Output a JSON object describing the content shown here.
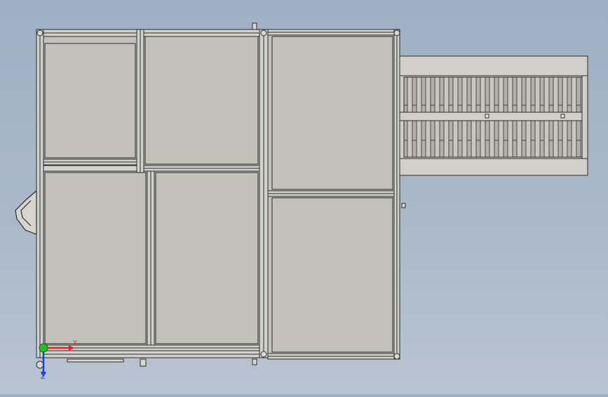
{
  "viewport": {
    "background_top": "#9fb0c4",
    "background_bottom": "#b8c4d2",
    "panel_fill": "#c2c2ba",
    "frame_color": "#2b2b2b",
    "frame_fill": "#d2d2cc"
  },
  "triad": {
    "x_label": "Y",
    "z_label": "Z",
    "x_color": "#e02020",
    "y_color": "#20c020",
    "z_color": "#2040d0"
  }
}
